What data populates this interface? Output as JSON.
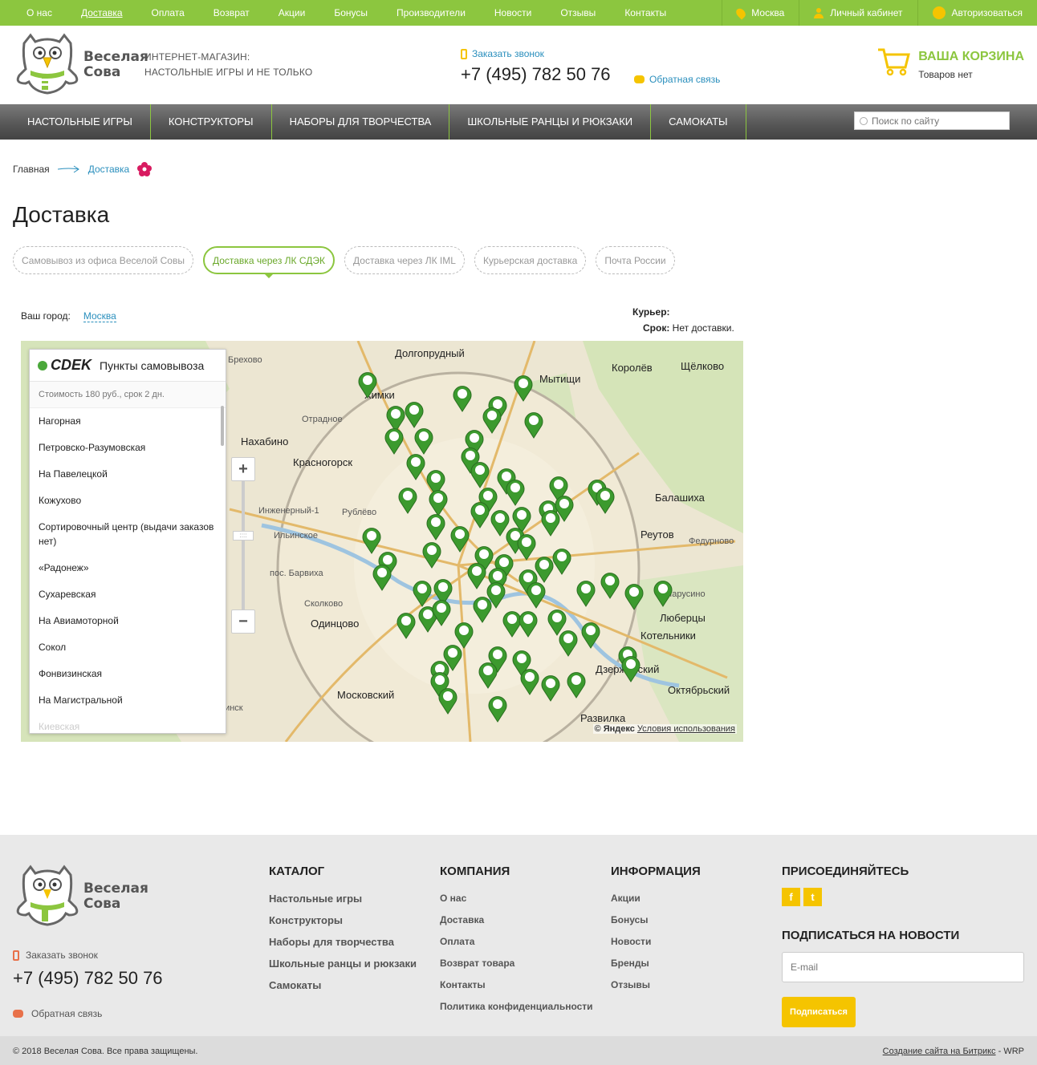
{
  "topbar": {
    "nav": [
      "О нас",
      "Доставка",
      "Оплата",
      "Возврат",
      "Акции",
      "Бонусы",
      "Производители",
      "Новости",
      "Отзывы",
      "Контакты"
    ],
    "active_index": 1,
    "city": "Москва",
    "cabinet": "Личный кабинет",
    "login": "Авторизоваться"
  },
  "header": {
    "logo_line1": "Веселая",
    "logo_line2": "Сова",
    "tagline1": "ИНТЕРНЕТ-МАГАЗИН:",
    "tagline2": "НАСТОЛЬНЫЕ ИГРЫ и НЕ ТОЛЬКО",
    "order_call": "Заказать звонок",
    "phone": "+7 (495) 782 50 76",
    "feedback": "Обратная связь",
    "cart_title": "ВАША КОРЗИНА",
    "cart_status": "Товаров нет"
  },
  "mainnav": {
    "items": [
      "НАСТОЛЬНЫЕ ИГРЫ",
      "КОНСТРУКТОРЫ",
      "НАБОРЫ ДЛЯ ТВОРЧЕСТВА",
      "ШКОЛЬНЫЕ РАНЦЫ И РЮКЗАКИ",
      "САМОКАТЫ"
    ],
    "search_placeholder": "Поиск по сайту"
  },
  "breadcrumb": {
    "home": "Главная",
    "current": "Доставка"
  },
  "page_title": "Доставка",
  "tabs": [
    "Самовывоз из офиса Веселой Совы",
    "Доставка через ЛК СДЭК",
    "Доставка через ЛК IML",
    "Курьерская доставка",
    "Почта России"
  ],
  "active_tab": 1,
  "city_label": "Ваш город:",
  "city_value": "Москва",
  "courier": {
    "label": "Курьер:",
    "term_label": "Срок:",
    "term_value": "Нет доставки."
  },
  "map": {
    "panel_brand": "CDEK",
    "panel_title": "Пункты самовывоза",
    "cost": "Стоимость 180 руб., срок 2 дн.",
    "points": [
      "Нагорная",
      "Петровско-Разумовская",
      "На Павелецкой",
      "Кожухово",
      "Сортировочный центр (выдачи заказов нет)",
      "«Радонеж»",
      "Сухаревская",
      "На Авиамоторной",
      "Сокол",
      "Фонвизинская",
      "На Магистральной",
      "Киевская"
    ],
    "labels": [
      "Долгопрудный",
      "Химки",
      "Мытищи",
      "Королёв",
      "Щёлково",
      "Нахабино",
      "Красногорск",
      "Балашиха",
      "Реутов",
      "Одинцово",
      "Люберцы",
      "Котельники",
      "Дзержинский",
      "Октябрьский",
      "Московский",
      "Развилка",
      "Ильинское",
      "Инженерный-1",
      "Бреховo",
      "Отрадное",
      "Рублёво",
      "пос. Барвиха",
      "Сколково",
      "Марусино",
      "Федурново",
      "Ногинск"
    ],
    "zoom_plus": "+",
    "zoom_minus": "−",
    "zoom_thumb": "::::",
    "copyright": "© Яндекс",
    "terms": "Условия использования"
  },
  "footer": {
    "catalog_title": "КАТАЛОГ",
    "catalog": [
      "Настольные игры",
      "Конструкторы",
      "Наборы для творчества",
      "Школьные ранцы и рюкзаки",
      "Самокаты"
    ],
    "company_title": "КОМПАНИЯ",
    "company": [
      "О нас",
      "Доставка",
      "Оплата",
      "Возврат товара",
      "Контакты",
      "Политика конфиденциальности"
    ],
    "info_title": "ИНФОРМАЦИЯ",
    "info": [
      "Акции",
      "Бонусы",
      "Новости",
      "Бренды",
      "Отзывы"
    ],
    "join_title": "ПРИСОЕДИНЯЙТЕСЬ",
    "social": [
      "f",
      "t"
    ],
    "subscribe_title": "ПОДПИСАТЬСЯ НА НОВОСТИ",
    "email_placeholder": "E-mail",
    "subscribe_btn": "Подписаться",
    "order_call": "Заказать звонок",
    "phone": "+7 (495) 782 50 76",
    "feedback": "Обратная связь",
    "copyright": "© 2018 Веселая Сова. Все права защищены.",
    "credits_link": "Создание сайта на Битрикс",
    "credits_suffix": " - WRP"
  },
  "colors": {
    "brand_green": "#8cc63f",
    "accent_yellow": "#f5c400",
    "link_blue": "#2a8fbd",
    "marker_green": "#3c9a2e"
  }
}
